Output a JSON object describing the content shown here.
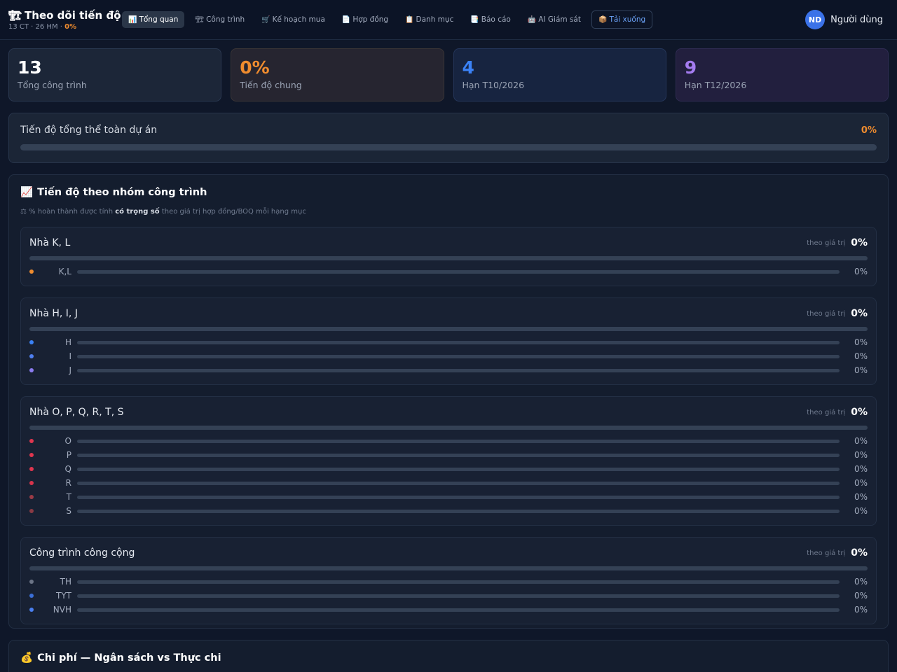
{
  "brand": {
    "icon": "🏗",
    "title": "Theo dõi tiến độ",
    "sub_prefix": "13 CT · 26 HM · ",
    "sub_pct": "0%"
  },
  "nav": [
    {
      "icon": "📊",
      "label": "Tổng quan",
      "active": true
    },
    {
      "icon": "🏗",
      "label": "Công trình"
    },
    {
      "icon": "🛒",
      "label": "Kế hoạch mua"
    },
    {
      "icon": "📄",
      "label": "Hợp đồng"
    },
    {
      "icon": "📋",
      "label": "Danh mục"
    },
    {
      "icon": "📑",
      "label": "Báo cáo"
    },
    {
      "icon": "🤖",
      "label": "AI Giám sát"
    },
    {
      "icon": "📦",
      "label": "Tải xuống"
    }
  ],
  "user": {
    "initials": "ND",
    "name": "Người dùng"
  },
  "stats": [
    {
      "value": "13",
      "label": "Tổng công trình"
    },
    {
      "value": "0%",
      "label": "Tiến độ chung"
    },
    {
      "value": "4",
      "label": "Hạn T10/2026"
    },
    {
      "value": "9",
      "label": "Hạn T12/2026"
    }
  ],
  "overall": {
    "title": "Tiến độ tổng thể toàn dự án",
    "pct": "0%",
    "progress": 0
  },
  "groups_panel": {
    "icon": "📈",
    "title": "Tiến độ theo nhóm công trình",
    "note_icon": "⚖",
    "note_pre": "% hoàn thành được tính ",
    "note_bold": "có trọng số",
    "note_post": " theo giá trị hợp đồng/BOQ mỗi hạng mục",
    "by_label": "theo giá trị"
  },
  "groups": [
    {
      "name": "Nhà K, L",
      "pct": "0%",
      "items": [
        {
          "label": "K,L",
          "pct": "0%",
          "color": "#f08c2e"
        }
      ]
    },
    {
      "name": "Nhà H, I, J",
      "pct": "0%",
      "items": [
        {
          "label": "H",
          "pct": "0%",
          "color": "#3b82f6"
        },
        {
          "label": "I",
          "pct": "0%",
          "color": "#4f7ff0"
        },
        {
          "label": "J",
          "pct": "0%",
          "color": "#8b7cf0"
        }
      ]
    },
    {
      "name": "Nhà O, P, Q, R, T, S",
      "pct": "0%",
      "items": [
        {
          "label": "O",
          "pct": "0%",
          "color": "#e0364f"
        },
        {
          "label": "P",
          "pct": "0%",
          "color": "#e0364f"
        },
        {
          "label": "Q",
          "pct": "0%",
          "color": "#e0364f"
        },
        {
          "label": "R",
          "pct": "0%",
          "color": "#d8344c"
        },
        {
          "label": "T",
          "pct": "0%",
          "color": "#9c3b46"
        },
        {
          "label": "S",
          "pct": "0%",
          "color": "#8a3a44"
        }
      ]
    },
    {
      "name": "Công trình công cộng",
      "pct": "0%",
      "items": [
        {
          "label": "TH",
          "pct": "0%",
          "color": "#6b7486"
        },
        {
          "label": "TYT",
          "pct": "0%",
          "color": "#3b6fd8"
        },
        {
          "label": "NVH",
          "pct": "0%",
          "color": "#4a7ff0"
        }
      ]
    }
  ],
  "cost": {
    "icon": "💰",
    "title": "Chi phí — Ngân sách vs Thực chi"
  }
}
